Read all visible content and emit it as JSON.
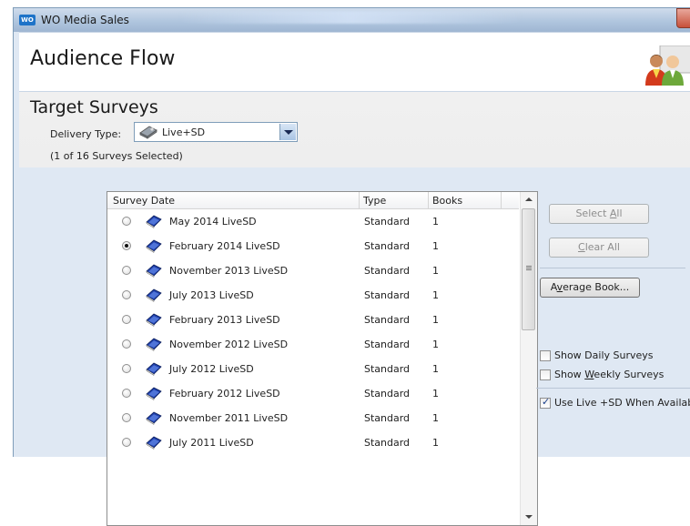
{
  "window": {
    "title": "WO Media Sales",
    "icon_text": "WO"
  },
  "header": {
    "title": "Audience Flow"
  },
  "section": {
    "title": "Target Surveys"
  },
  "delivery": {
    "label": "Delivery Type:",
    "value": "Live+SD"
  },
  "selected_count": "(1 of 16 Surveys Selected)",
  "grid": {
    "columns": [
      "Survey Date",
      "Type",
      "Books"
    ],
    "rows": [
      {
        "name": "May 2014 LiveSD",
        "type": "Standard",
        "books": "1",
        "selected": false
      },
      {
        "name": "February 2014 LiveSD",
        "type": "Standard",
        "books": "1",
        "selected": true
      },
      {
        "name": "November 2013 LiveSD",
        "type": "Standard",
        "books": "1",
        "selected": false
      },
      {
        "name": "July 2013 LiveSD",
        "type": "Standard",
        "books": "1",
        "selected": false
      },
      {
        "name": "February 2013 LiveSD",
        "type": "Standard",
        "books": "1",
        "selected": false
      },
      {
        "name": "November 2012 LiveSD",
        "type": "Standard",
        "books": "1",
        "selected": false
      },
      {
        "name": "July 2012 LiveSD",
        "type": "Standard",
        "books": "1",
        "selected": false
      },
      {
        "name": "February 2012 LiveSD",
        "type": "Standard",
        "books": "1",
        "selected": false
      },
      {
        "name": "November 2011 LiveSD",
        "type": "Standard",
        "books": "1",
        "selected": false
      },
      {
        "name": "July 2011 LiveSD",
        "type": "Standard",
        "books": "1",
        "selected": false
      }
    ]
  },
  "buttons": {
    "select_all": {
      "pre": "Select ",
      "key": "A",
      "post": "ll"
    },
    "clear_all": {
      "pre": "",
      "key": "C",
      "post": "lear All"
    },
    "average_book": {
      "pre": "A",
      "key": "v",
      "post": "erage Book..."
    }
  },
  "options": {
    "show_daily": {
      "label": "Show Daily Surveys",
      "checked": false
    },
    "show_weekly": {
      "pre": "Show ",
      "key": "W",
      "post": "eekly Surveys",
      "checked": false
    },
    "use_live": {
      "label": "Use Live +SD  When Available",
      "checked": true
    }
  },
  "colors": {
    "accent": "#1e73c8",
    "window_bg": "#dfe8f3",
    "book_blue": "#1f3fa8"
  }
}
